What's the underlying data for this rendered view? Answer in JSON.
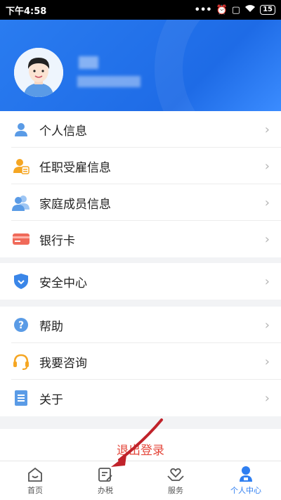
{
  "status_bar": {
    "time": "下午4:58",
    "battery": "15"
  },
  "menu_group1": [
    {
      "label": "个人信息",
      "icon": "person-icon"
    },
    {
      "label": "任职受雇信息",
      "icon": "employment-icon"
    },
    {
      "label": "家庭成员信息",
      "icon": "family-icon"
    },
    {
      "label": "银行卡",
      "icon": "bank-card-icon"
    }
  ],
  "menu_group2": [
    {
      "label": "安全中心",
      "icon": "shield-icon"
    }
  ],
  "menu_group3": [
    {
      "label": "帮助",
      "icon": "question-icon"
    },
    {
      "label": "我要咨询",
      "icon": "headset-icon"
    },
    {
      "label": "关于",
      "icon": "document-icon"
    }
  ],
  "logout_label": "退出登录",
  "tabs": [
    {
      "label": "首页",
      "icon": "home-icon"
    },
    {
      "label": "办税",
      "icon": "tax-doc-icon"
    },
    {
      "label": "服务",
      "icon": "heart-hand-icon"
    },
    {
      "label": "个人中心",
      "icon": "person-center-icon"
    }
  ],
  "colors": {
    "accent": "#2f7ff1",
    "logout": "#e4463a",
    "header": "#1e6be6"
  }
}
